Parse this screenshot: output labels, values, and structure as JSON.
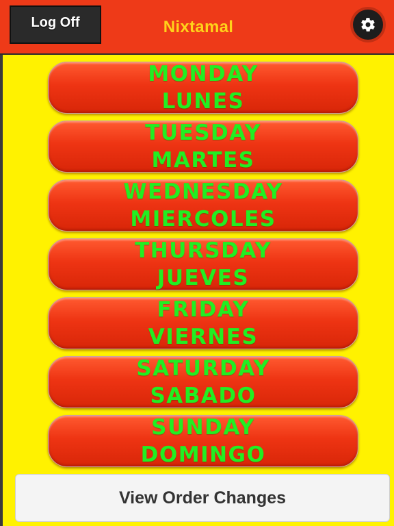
{
  "header": {
    "logoff_label": "Log Off",
    "title": "Nixtamal",
    "settings_icon": "gear-icon"
  },
  "days": [
    {
      "english": "MONDAY",
      "spanish": "LUNES"
    },
    {
      "english": "TUESDAY",
      "spanish": "MARTES"
    },
    {
      "english": "WEDNESDAY",
      "spanish": "MIERCOLES"
    },
    {
      "english": "THURSDAY",
      "spanish": "JUEVES"
    },
    {
      "english": "FRIDAY",
      "spanish": "VIERNES"
    },
    {
      "english": "SATURDAY",
      "spanish": "SABADO"
    },
    {
      "english": "SUNDAY",
      "spanish": "DOMINGO"
    }
  ],
  "footer": {
    "view_changes_label": "View Order Changes"
  },
  "colors": {
    "header_bg": "#ee3a18",
    "content_bg": "#fff200",
    "day_button": "#ee3413",
    "day_text": "#22ee22",
    "title_text": "#ffd21a"
  }
}
